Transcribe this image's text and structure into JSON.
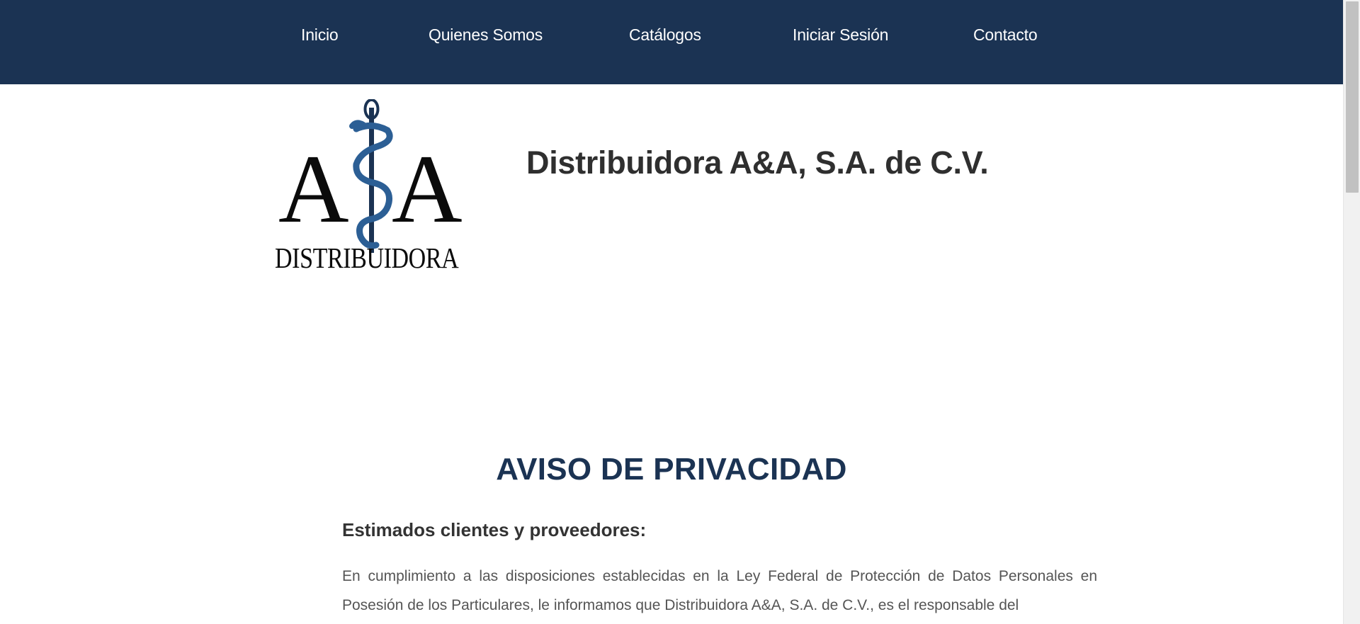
{
  "nav": {
    "items": [
      {
        "label": "Inicio"
      },
      {
        "label": "Quienes Somos"
      },
      {
        "label": "Catálogos"
      },
      {
        "label": "Iniciar Sesión"
      },
      {
        "label": "Contacto"
      }
    ]
  },
  "header": {
    "logo": {
      "letter_left": "A",
      "letter_right": "A",
      "wordmark": "DISTRIBUIDORA"
    },
    "company_name": "Distribuidora A&A, S.A. de C.V."
  },
  "content": {
    "section_title": "AVISO DE PRIVACIDAD",
    "greeting": "Estimados clientes y proveedores:",
    "paragraph": "En cumplimiento a las disposiciones establecidas en la Ley Federal de Protección de Datos Personales en Posesión de los Particulares, le informamos que Distribuidora A&A, S.A. de C.V., es el responsable del"
  },
  "colors": {
    "nav_background": "#1b3353",
    "title_color": "#1b3353",
    "logo_snake": "#2c5f95",
    "logo_text": "#0b0b0b"
  }
}
